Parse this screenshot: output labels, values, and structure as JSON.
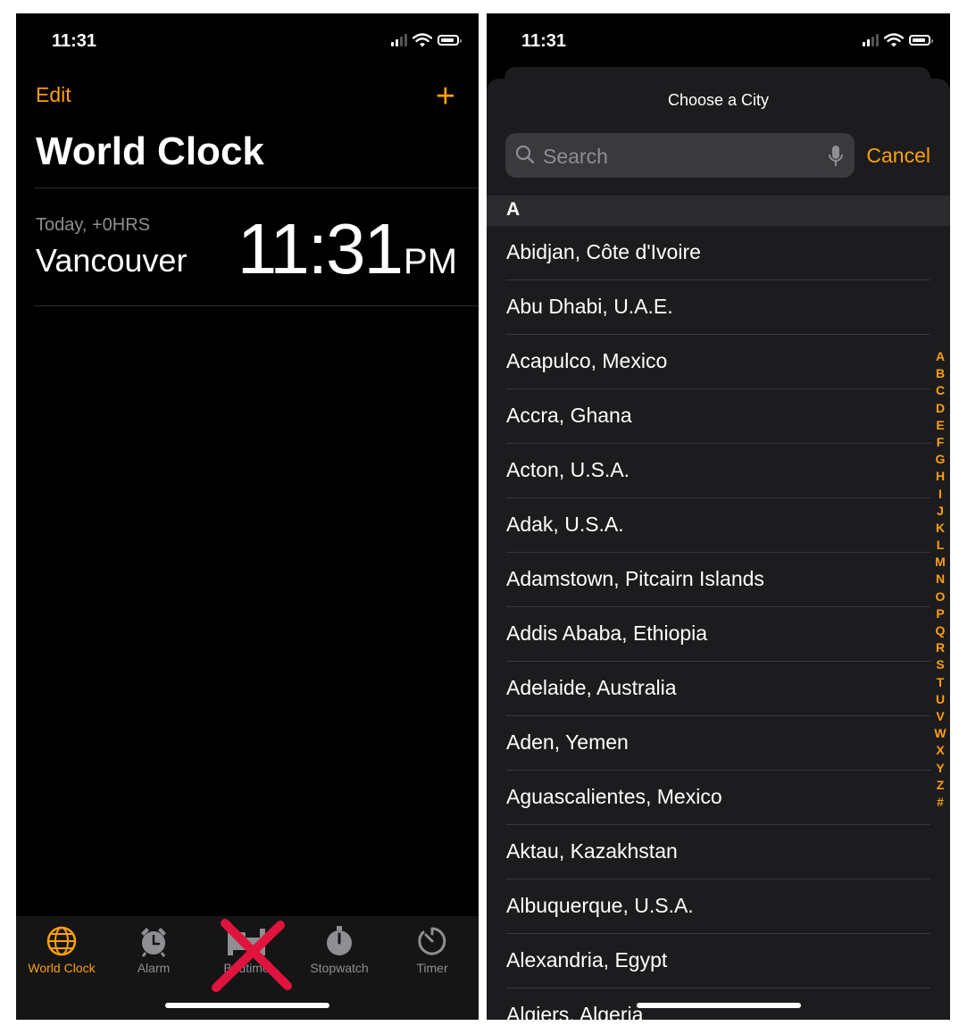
{
  "left_screen": {
    "status": {
      "time": "11:31"
    },
    "nav": {
      "edit_label": "Edit",
      "add_label": "+"
    },
    "title": "World Clock",
    "clocks": [
      {
        "offset": "Today, +0HRS",
        "city": "Vancouver",
        "time": "11:31",
        "ampm": "PM"
      }
    ],
    "tabbar": {
      "items": [
        {
          "label": "World Clock",
          "icon": "globe-icon",
          "active": true
        },
        {
          "label": "Alarm",
          "icon": "alarm-clock-icon",
          "active": false
        },
        {
          "label": "Bedtime",
          "icon": "bed-icon",
          "active": false
        },
        {
          "label": "Stopwatch",
          "icon": "stopwatch-icon",
          "active": false
        },
        {
          "label": "Timer",
          "icon": "timer-icon",
          "active": false
        }
      ],
      "annotation": "red-x-over-bedtime"
    },
    "colors": {
      "accent": "#ff9f0a",
      "background": "#000000",
      "annotation": "#e0143c"
    }
  },
  "right_screen": {
    "status": {
      "time": "11:31"
    },
    "sheet_title": "Choose a City",
    "search": {
      "placeholder": "Search",
      "value": ""
    },
    "cancel_label": "Cancel",
    "section_header": "A",
    "cities": [
      "Abidjan, Côte d'Ivoire",
      "Abu Dhabi, U.A.E.",
      "Acapulco, Mexico",
      "Accra, Ghana",
      "Acton, U.S.A.",
      "Adak, U.S.A.",
      "Adamstown, Pitcairn Islands",
      "Addis Ababa, Ethiopia",
      "Adelaide, Australia",
      "Aden, Yemen",
      "Aguascalientes, Mexico",
      "Aktau, Kazakhstan",
      "Albuquerque, U.S.A.",
      "Alexandria, Egypt",
      "Algiers, Algeria"
    ],
    "index_letters": [
      "A",
      "B",
      "C",
      "D",
      "E",
      "F",
      "G",
      "H",
      "I",
      "J",
      "K",
      "L",
      "M",
      "N",
      "O",
      "P",
      "Q",
      "R",
      "S",
      "T",
      "U",
      "V",
      "W",
      "X",
      "Y",
      "Z",
      "#"
    ]
  }
}
